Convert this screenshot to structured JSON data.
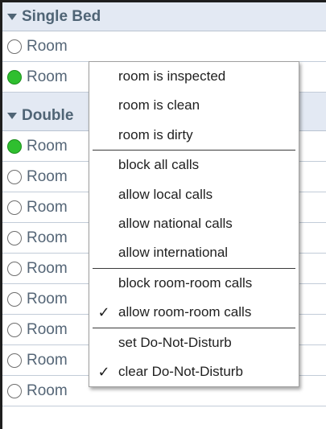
{
  "groups": [
    {
      "name": "Single Bed"
    },
    {
      "name": "Double"
    }
  ],
  "rooms": [
    {
      "label": "Room",
      "status": "empty"
    },
    {
      "label": "Room",
      "status": "green"
    },
    {
      "label": "Room",
      "status": "green"
    },
    {
      "label": "Room",
      "status": "empty"
    },
    {
      "label": "Room",
      "status": "empty"
    },
    {
      "label": "Room",
      "status": "empty"
    },
    {
      "label": "Room",
      "status": "empty"
    },
    {
      "label": "Room",
      "status": "empty"
    },
    {
      "label": "Room",
      "status": "empty"
    },
    {
      "label": "Room",
      "status": "empty"
    }
  ],
  "menu": {
    "items": [
      {
        "label": "room is inspected",
        "checked": false
      },
      {
        "label": "room is clean",
        "checked": false
      },
      {
        "label": "room is dirty",
        "checked": false
      },
      {
        "label": "block all calls",
        "checked": false
      },
      {
        "label": "allow local calls",
        "checked": false
      },
      {
        "label": "allow national calls",
        "checked": false
      },
      {
        "label": "allow international",
        "checked": false
      },
      {
        "label": "block room-room calls",
        "checked": false
      },
      {
        "label": "allow room-room calls",
        "checked": true
      },
      {
        "label": "set Do-Not-Disturb",
        "checked": false
      },
      {
        "label": "clear Do-Not-Disturb",
        "checked": true
      }
    ],
    "check_glyph": "✓"
  },
  "colors": {
    "header_bg": "#e3e9f3",
    "header_text": "#4f6475",
    "status_green": "#2fbf2f",
    "status_empty_border": "#6f6f6f"
  }
}
